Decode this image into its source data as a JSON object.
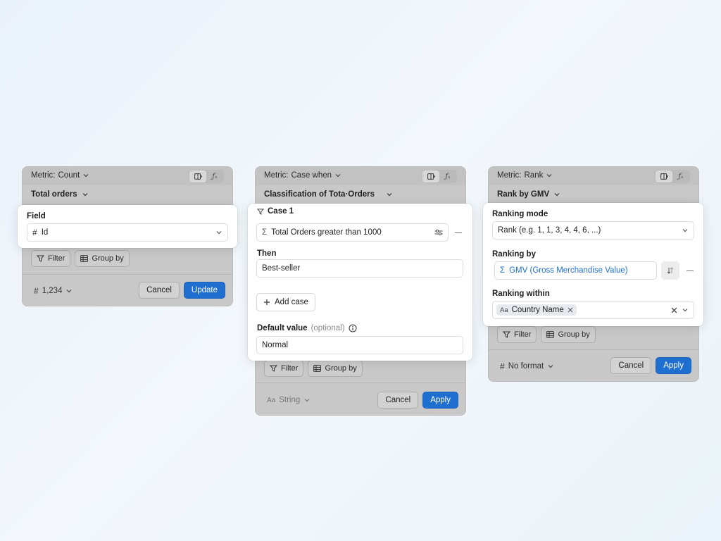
{
  "panels": [
    {
      "header_label": "Metric:",
      "header_value": "Count",
      "subtitle": "Total orders",
      "chips": [
        "Filter",
        "Group by"
      ],
      "format_label": "1,234",
      "buttons": {
        "cancel": "Cancel",
        "confirm": "Update"
      },
      "card": {
        "field_label": "Field",
        "field_value": "Id"
      }
    },
    {
      "header_label": "Metric:",
      "header_value": "Case when",
      "subtitle": "Classification of Tota·Orders",
      "chips": [
        "Filter",
        "Group by"
      ],
      "format_label": "String",
      "buttons": {
        "cancel": "Cancel",
        "confirm": "Apply"
      },
      "card": {
        "case_label": "Case 1",
        "case_condition": "Total Orders greater than 1000",
        "then_label": "Then",
        "then_value": "Best-seller",
        "add_case": "Add case",
        "default_label": "Default value",
        "default_optional": "(optional)",
        "default_value": "Normal"
      }
    },
    {
      "header_label": "Metric:",
      "header_value": "Rank",
      "subtitle": "Rank by GMV",
      "chips": [
        "Filter",
        "Group by"
      ],
      "format_label": "No format",
      "buttons": {
        "cancel": "Cancel",
        "confirm": "Apply"
      },
      "card": {
        "mode_label": "Ranking mode",
        "mode_value": "Rank (e.g. 1, 1, 3, 4, 4, 6, ...)",
        "by_label": "Ranking by",
        "by_value": "GMV (Gross Merchandise Value)",
        "within_label": "Ranking within",
        "within_tag": "Country Name"
      }
    }
  ],
  "colors": {
    "primary": "#1f6fd1",
    "panel_bg": "#c8c8c8",
    "page_bg": "#eef4fa"
  },
  "icons": {
    "header_toggle": [
      "panel-icon",
      "fx-icon"
    ],
    "hash": "hash-icon",
    "sigma": "sigma-icon",
    "filter": "filter-icon",
    "group": "table-icon",
    "text_type": "text-type-icon"
  }
}
